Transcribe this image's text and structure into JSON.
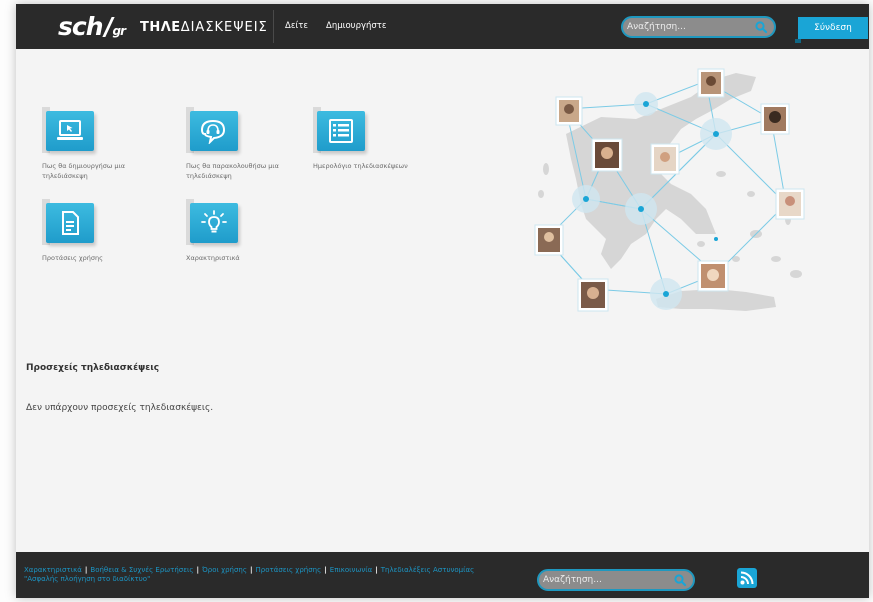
{
  "header": {
    "logo_sch": "sch",
    "logo_gr": "gr",
    "logo_tele_bold": "ΤΗΛΕ",
    "logo_tele_thin": "ΔΙΑΣΚΕΨΕΙΣ",
    "nav": [
      {
        "label": "Δείτε"
      },
      {
        "label": "Δημιουργήστε"
      }
    ],
    "search_placeholder": "Αναζήτηση...",
    "login_label": "Σύνδεση"
  },
  "tiles": [
    {
      "label": "Πως θα δημιουργήσω μια τηλεδιάσκεψη",
      "icon": "laptop-icon"
    },
    {
      "label": "Πως θα παρακολουθήσω μια τηλεδιάσκεψη",
      "icon": "headset-chat-icon"
    },
    {
      "label": "Ημερολόγιο τηλεδιασκέψεων",
      "icon": "calendar-list-icon"
    },
    {
      "label": "Προτάσεις χρήσης",
      "icon": "document-icon"
    },
    {
      "label": "Χαρακτηριστικά",
      "icon": "lightbulb-icon"
    }
  ],
  "main": {
    "upcoming_title": "Προσεχείς τηλεδιασκέψεις",
    "upcoming_empty": "Δεν υπάρχουν προσεχείς τηλεδιασκέψεις."
  },
  "footer": {
    "links": [
      "Χαρακτηριστικά",
      "Βοήθεια & Συχνές Ερωτήσεις",
      "Όροι χρήσης",
      "Προτάσεις χρήσης",
      "Επικοινωνία",
      "Τηλεδιαλέξεις Αστυνομίας \"Ασφαλής πλοήγηση στο διαδίκτυο\""
    ],
    "search_placeholder": "Αναζήτηση...",
    "rss_icon": "rss-icon"
  },
  "colors": {
    "accent": "#1aa5d6",
    "header_bg": "#2a2a2a",
    "tile_blue": "#2aaad6",
    "link_blue": "#1c95c4"
  }
}
